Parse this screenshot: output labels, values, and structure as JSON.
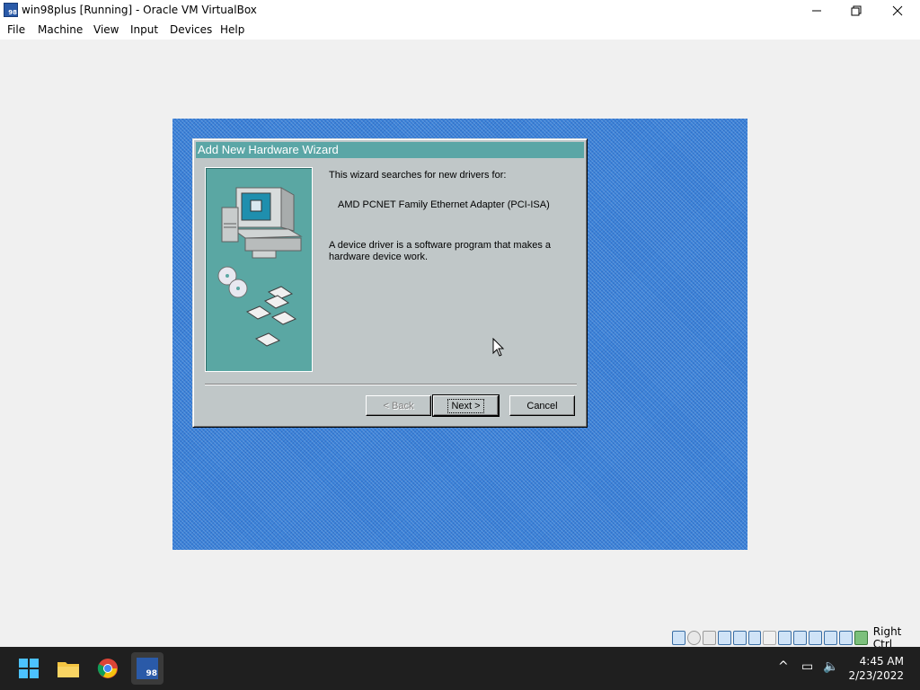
{
  "window": {
    "title": "win98plus [Running] - Oracle VM VirtualBox",
    "icon_badge": "98",
    "controls": [
      "minimize-icon",
      "restore-icon",
      "close-icon"
    ]
  },
  "menu": {
    "items": [
      "File",
      "Machine",
      "View",
      "Input",
      "Devices",
      "Help"
    ]
  },
  "guest": {
    "desktop_color": "#3b82d8",
    "dialog": {
      "title": "Add New Hardware Wizard",
      "intro": "This wizard searches for new drivers for:",
      "device": "AMD PCNET Family Ethernet Adapter (PCI-ISA)",
      "description_line1": "A device driver is a software program that makes a",
      "description_line2": "hardware device work.",
      "buttons": {
        "back": "< Back",
        "next": "Next >",
        "cancel": "Cancel"
      }
    }
  },
  "statusbar": {
    "icons": [
      "hard-disk-icon",
      "optical-drive-icon",
      "floppy-icon",
      "audio-icon",
      "network-icon",
      "usb-icon",
      "shared-folders-icon",
      "display-icon",
      "video-capture-icon",
      "recording-icon",
      "cpu-icon",
      "mouse-integration-icon",
      "arrow-icon"
    ],
    "host_key": "Right Ctrl"
  },
  "taskbar": {
    "apps": [
      "windows-start-icon",
      "file-explorer-icon",
      "chrome-icon",
      "virtualbox-icon"
    ],
    "clock_time": "4:45 AM",
    "clock_date": "2/23/2022"
  }
}
